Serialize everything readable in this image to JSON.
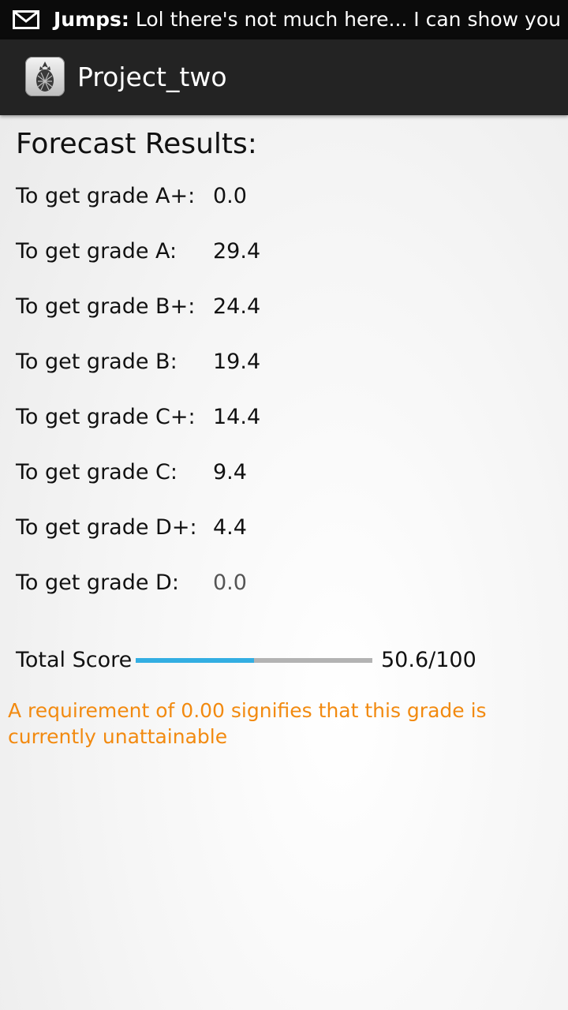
{
  "status_bar": {
    "sender": "Jumps:",
    "message": "Lol there's not much here... I can show you",
    "icon": "mail-icon"
  },
  "action_bar": {
    "app_title": "Project_two",
    "app_icon": "pineapple-icon"
  },
  "forecast": {
    "heading": "Forecast Results:",
    "rows": [
      {
        "label": "To get grade A+:",
        "value": "0.0"
      },
      {
        "label": "To get grade A:",
        "value": "29.4"
      },
      {
        "label": "To get grade B+:",
        "value": "24.4"
      },
      {
        "label": "To get grade B:",
        "value": "19.4"
      },
      {
        "label": "To get grade C+:",
        "value": "14.4"
      },
      {
        "label": "To get grade C:",
        "value": "9.4"
      },
      {
        "label": "To get grade D+:",
        "value": "4.4"
      },
      {
        "label": "To get grade D:",
        "value": "0.0"
      }
    ]
  },
  "total_score": {
    "label": "Total Score",
    "value_text": "50.6/100",
    "progress_fraction": 0.5,
    "bar_color": "#33aee2",
    "track_color": "#b3b3b3"
  },
  "note": "A requirement of 0.00 signifies that this grade is currently unattainable",
  "colors": {
    "note": "#f28a10",
    "status_bar_bg": "#0b0b0b",
    "action_bar_bg": "#232323"
  }
}
